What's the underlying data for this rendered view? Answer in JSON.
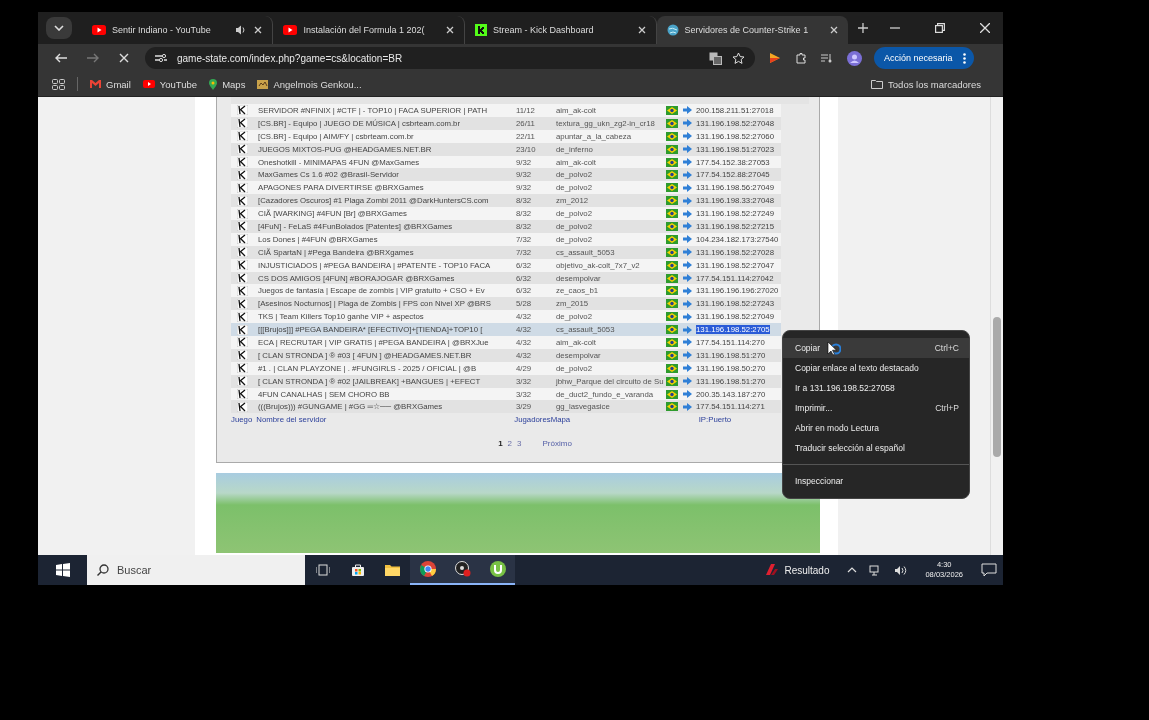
{
  "browser": {
    "tabs": [
      {
        "kind": "youtube",
        "title": "Sentir Indiano - YouTube",
        "audio": true,
        "selected": false
      },
      {
        "kind": "youtube",
        "title": "Instalación del Formula 1 202(",
        "audio": false,
        "selected": false
      },
      {
        "kind": "kick",
        "title": "Stream - Kick Dashboard",
        "audio": false,
        "selected": false
      },
      {
        "kind": "globe",
        "title": "Servidores de Counter-Strike 1",
        "audio": false,
        "selected": true
      }
    ],
    "address": "game-state.com/index.php?game=cs&location=BR",
    "bookmarks": [
      {
        "kind": "gmail",
        "label": "Gmail"
      },
      {
        "kind": "youtube",
        "label": "YouTube"
      },
      {
        "kind": "maps",
        "label": "Maps"
      },
      {
        "kind": "page",
        "label": "Angelmois Genkou..."
      }
    ],
    "all_bookmarks": "Todos los marcadores",
    "action_button": "Acción necesaria"
  },
  "server_table": {
    "rows": [
      {
        "name": "SERVIDOR #NFINIX | #CTF | - TOP10 | FACA SUPERIOR | PATH",
        "players": "11/12",
        "map": "aim_ak-colt",
        "ip": "200.158.211.51:27018",
        "selected": false
      },
      {
        "name": "[CS.BR] - Equipo | JUEGO DE MÚSICA | csbrteam.com.br",
        "players": "26/11",
        "map": "textura_gg_ukn_zg2-in_cr18",
        "ip": "131.196.198.52:27048",
        "selected": false
      },
      {
        "name": "[CS.BR] - Equipo | AIM/FY | csbrteam.com.br",
        "players": "22/11",
        "map": "apuntar_a_la_cabeza",
        "ip": "131.196.198.52:27060",
        "selected": false
      },
      {
        "name": "JUEGOS MIXTOS-PUG @HEADGAMES.NET.BR",
        "players": "23/10",
        "map": "de_inferno",
        "ip": "131.196.198.51:27023",
        "selected": false
      },
      {
        "name": "Oneshotkill - MINIMAPAS 4FUN @MaxGames",
        "players": "9/32",
        "map": "aim_ak-colt",
        "ip": "177.54.152.38:27053",
        "selected": false
      },
      {
        "name": "MaxGames Cs 1.6 #02 @Brasil-Servidor",
        "players": "9/32",
        "map": "de_polvo2",
        "ip": "177.54.152.88:27045",
        "selected": false
      },
      {
        "name": "APAGONES PARA DIVERTIRSE @BRXGames",
        "players": "9/32",
        "map": "de_polvo2",
        "ip": "131.196.198.56:27049",
        "selected": false
      },
      {
        "name": "[Cazadores Oscuros] #1 Plaga Zombi 2011 @DarkHuntersCS.com",
        "players": "8/32",
        "map": "zm_2012",
        "ip": "131.196.198.33:27048",
        "selected": false
      },
      {
        "name": "CIÃ [WARKING] #4FUN [Br] @BRXGames",
        "players": "8/32",
        "map": "de_polvo2",
        "ip": "131.196.198.52:27249",
        "selected": false
      },
      {
        "name": "[4FuN] - FeLaS #4FunBolados [Patentes] @BRXGames",
        "players": "8/32",
        "map": "de_polvo2",
        "ip": "131.196.198.52:27215",
        "selected": false
      },
      {
        "name": "Los Dones | #4FUN @BRXGames",
        "players": "7/32",
        "map": "de_polvo2",
        "ip": "104.234.182.173:27540",
        "selected": false
      },
      {
        "name": "CIÃ SpartaN | #Pega Bandeira @BRXgames",
        "players": "7/32",
        "map": "cs_assault_5053",
        "ip": "131.196.198.52:27028",
        "selected": false
      },
      {
        "name": "INJUSTICIADOS | #PEGA BANDEIRA | #PATENTE - TOP10 FACA",
        "players": "6/32",
        "map": "objetivo_ak-colt_7x7_v2",
        "ip": "131.196.198.52:27047",
        "selected": false
      },
      {
        "name": "CS DOS AMIGOS [4FUN] #BORAJOGAR @BRXGames",
        "players": "6/32",
        "map": "desempolvar",
        "ip": "177.54.151.114:27042",
        "selected": false
      },
      {
        "name": "Juegos de fantasía | Escape de zombis | VIP gratuito + CSO + Ev",
        "players": "6/32",
        "map": "ze_caos_b1",
        "ip": "131.196.196.196:27020",
        "selected": false
      },
      {
        "name": "[Asesinos Nocturnos] | Plaga de Zombis | FPS con Nivel XP @BRS",
        "players": "5/28",
        "map": "zm_2015",
        "ip": "131.196.198.52:27243",
        "selected": false
      },
      {
        "name": "TKS | Team Killers Top10 ganhe VIP + aspectos",
        "players": "4/32",
        "map": "de_polvo2",
        "ip": "131.196.198.52:27049",
        "selected": false
      },
      {
        "name": "[[[Brujos]]] #PEGA BANDEIRA* [EFECTIVO]+[TIENDA]+TOP10 [",
        "players": "4/32",
        "map": "cs_assault_5053",
        "ip": "131.196.198.52:2705",
        "selected": true
      },
      {
        "name": "ECA | RECRUTAR | VIP GRATIS | #PEGA BANDEIRA | @BRXJue",
        "players": "4/32",
        "map": "aim_ak-colt",
        "ip": "177.54.151.114:270",
        "selected": false
      },
      {
        "name": "[ CLAN STRONDA ] ® #03 [ 4FUN ] @HEADGAMES.NET.BR",
        "players": "4/32",
        "map": "desempolvar",
        "ip": "131.196.198.51:270",
        "selected": false
      },
      {
        "name": "#1 . | CLAN PLAYZONE | . #FUNGIRLS - 2025 / OFICIAL | @B",
        "players": "4/29",
        "map": "de_polvo2",
        "ip": "131.196.198.50:270",
        "selected": false
      },
      {
        "name": "[ CLAN STRONDA ] ® #02 [JAILBREAK] +BANGUES | +EFECT",
        "players": "3/32",
        "map": "jbhw_Parque del circuito de Su",
        "ip": "131.196.198.51:270",
        "selected": false
      },
      {
        "name": "4FUN CANALHAS | SEM CHORO BB",
        "players": "3/32",
        "map": "de_duct2_fundo_e_varanda",
        "ip": "200.35.143.187:270",
        "selected": false
      },
      {
        "name": "(((Brujos))) #GUNGAME | #GG ═☆── @BRXGames",
        "players": "3/29",
        "map": "gg_lasvegasice",
        "ip": "177.54.151.114:271",
        "selected": false
      }
    ],
    "footer": {
      "game": "Juego",
      "name": "Nombre del servidor",
      "players": "Jugadores",
      "map": "Mapa",
      "ip": "IP:Puerto"
    }
  },
  "pagination": {
    "pages": [
      {
        "label": "1",
        "selected": true
      },
      {
        "label": "2",
        "selected": false
      },
      {
        "label": "3",
        "selected": false
      }
    ],
    "next": "Próximo"
  },
  "context_menu": {
    "items": [
      {
        "kind": "item",
        "label": "Copiar",
        "shortcut": "Ctrl+C",
        "hovered": true
      },
      {
        "kind": "item",
        "label": "Copiar enlace al texto destacado",
        "hovered": false
      },
      {
        "kind": "item",
        "label": "Ir a 131.196.198.52:27058",
        "hovered": false
      },
      {
        "kind": "item",
        "label": "Imprimir...",
        "shortcut": "Ctrl+P",
        "hovered": false
      },
      {
        "kind": "item",
        "label": "Abrir en modo Lectura",
        "hovered": false
      },
      {
        "kind": "item",
        "label": "Traducir selección al español",
        "hovered": false
      },
      {
        "kind": "divider"
      },
      {
        "kind": "item",
        "label": "Inspeccionar",
        "hovered": false
      }
    ]
  },
  "taskbar": {
    "search_placeholder": "Buscar",
    "apps": [
      {
        "kind": "taskview",
        "running": false
      },
      {
        "kind": "store",
        "running": false
      },
      {
        "kind": "folder",
        "running": false
      },
      {
        "kind": "chrome",
        "running": true
      },
      {
        "kind": "recorder",
        "running": true
      },
      {
        "kind": "torrent",
        "running": true
      }
    ],
    "weather": "Resultado",
    "time": "4:30",
    "date": "08/03/2026"
  }
}
